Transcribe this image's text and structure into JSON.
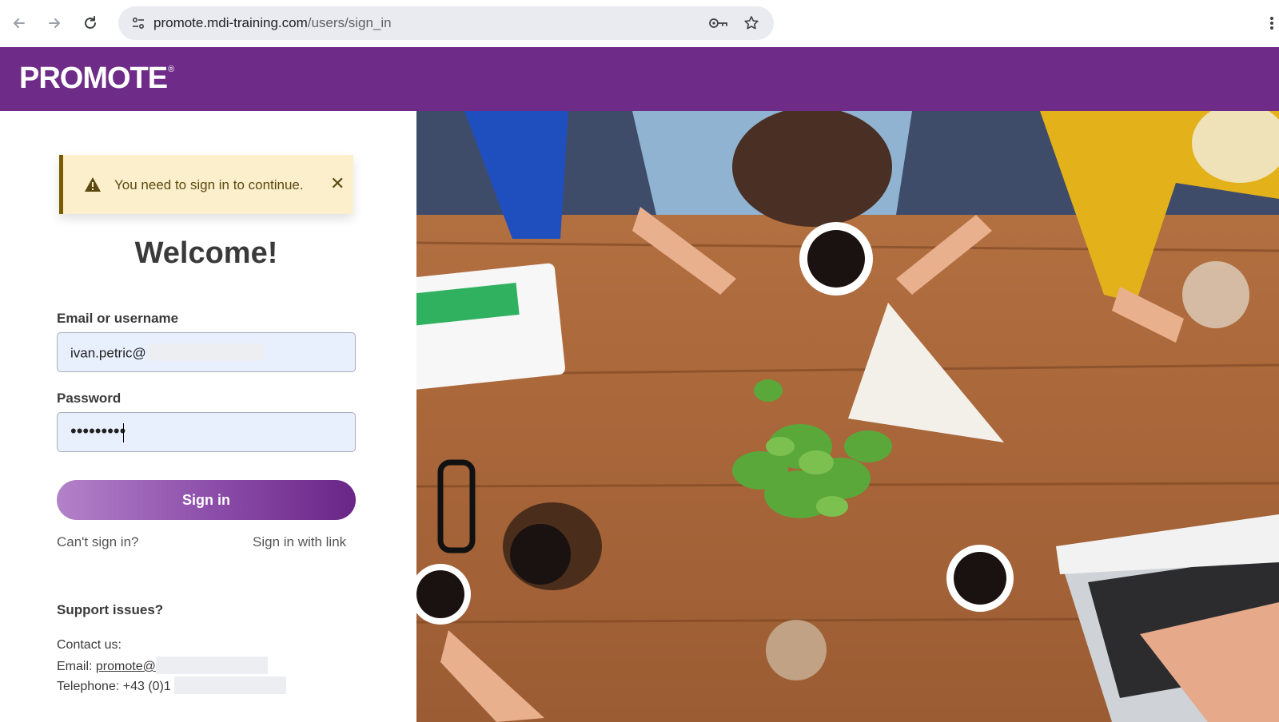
{
  "browser": {
    "url_domain": "promote.mdi-training.com",
    "url_path": "/users/sign_in"
  },
  "header": {
    "logo_text": "PROMOTE",
    "logo_mark": "®",
    "brand_color": "#6e2b87"
  },
  "alert": {
    "message": "You need to sign in to continue.",
    "close_glyph": "✕",
    "icon": "warning-icon"
  },
  "form": {
    "title": "Welcome!",
    "email_label": "Email or username",
    "email_value": "ivan.petric@",
    "password_label": "Password",
    "password_mask": "•••••••••",
    "submit_label": "Sign in",
    "cant_sign_in": "Can't sign in?",
    "sign_in_with_link": "Sign in with link"
  },
  "support": {
    "title": "Support issues?",
    "contact_label": "Contact us:",
    "email_prefix": "Email: ",
    "email_link": "promote@",
    "phone_prefix": "Telephone: +43 (0)1"
  }
}
